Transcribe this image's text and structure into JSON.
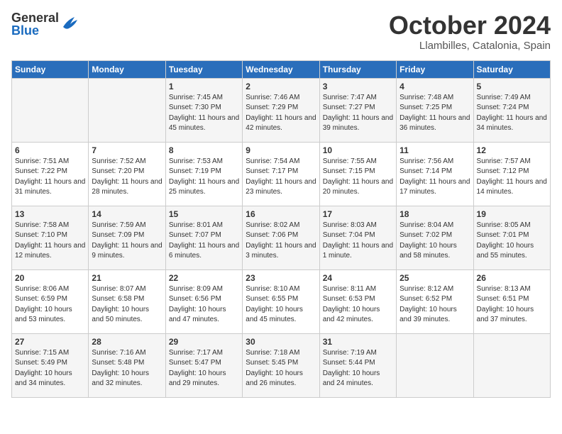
{
  "header": {
    "logo_general": "General",
    "logo_blue": "Blue",
    "month": "October 2024",
    "location": "Llambilles, Catalonia, Spain"
  },
  "days_of_week": [
    "Sunday",
    "Monday",
    "Tuesday",
    "Wednesday",
    "Thursday",
    "Friday",
    "Saturday"
  ],
  "weeks": [
    [
      {
        "day": "",
        "info": ""
      },
      {
        "day": "",
        "info": ""
      },
      {
        "day": "1",
        "info": "Sunrise: 7:45 AM\nSunset: 7:30 PM\nDaylight: 11 hours and 45 minutes."
      },
      {
        "day": "2",
        "info": "Sunrise: 7:46 AM\nSunset: 7:29 PM\nDaylight: 11 hours and 42 minutes."
      },
      {
        "day": "3",
        "info": "Sunrise: 7:47 AM\nSunset: 7:27 PM\nDaylight: 11 hours and 39 minutes."
      },
      {
        "day": "4",
        "info": "Sunrise: 7:48 AM\nSunset: 7:25 PM\nDaylight: 11 hours and 36 minutes."
      },
      {
        "day": "5",
        "info": "Sunrise: 7:49 AM\nSunset: 7:24 PM\nDaylight: 11 hours and 34 minutes."
      }
    ],
    [
      {
        "day": "6",
        "info": "Sunrise: 7:51 AM\nSunset: 7:22 PM\nDaylight: 11 hours and 31 minutes."
      },
      {
        "day": "7",
        "info": "Sunrise: 7:52 AM\nSunset: 7:20 PM\nDaylight: 11 hours and 28 minutes."
      },
      {
        "day": "8",
        "info": "Sunrise: 7:53 AM\nSunset: 7:19 PM\nDaylight: 11 hours and 25 minutes."
      },
      {
        "day": "9",
        "info": "Sunrise: 7:54 AM\nSunset: 7:17 PM\nDaylight: 11 hours and 23 minutes."
      },
      {
        "day": "10",
        "info": "Sunrise: 7:55 AM\nSunset: 7:15 PM\nDaylight: 11 hours and 20 minutes."
      },
      {
        "day": "11",
        "info": "Sunrise: 7:56 AM\nSunset: 7:14 PM\nDaylight: 11 hours and 17 minutes."
      },
      {
        "day": "12",
        "info": "Sunrise: 7:57 AM\nSunset: 7:12 PM\nDaylight: 11 hours and 14 minutes."
      }
    ],
    [
      {
        "day": "13",
        "info": "Sunrise: 7:58 AM\nSunset: 7:10 PM\nDaylight: 11 hours and 12 minutes."
      },
      {
        "day": "14",
        "info": "Sunrise: 7:59 AM\nSunset: 7:09 PM\nDaylight: 11 hours and 9 minutes."
      },
      {
        "day": "15",
        "info": "Sunrise: 8:01 AM\nSunset: 7:07 PM\nDaylight: 11 hours and 6 minutes."
      },
      {
        "day": "16",
        "info": "Sunrise: 8:02 AM\nSunset: 7:06 PM\nDaylight: 11 hours and 3 minutes."
      },
      {
        "day": "17",
        "info": "Sunrise: 8:03 AM\nSunset: 7:04 PM\nDaylight: 11 hours and 1 minute."
      },
      {
        "day": "18",
        "info": "Sunrise: 8:04 AM\nSunset: 7:02 PM\nDaylight: 10 hours and 58 minutes."
      },
      {
        "day": "19",
        "info": "Sunrise: 8:05 AM\nSunset: 7:01 PM\nDaylight: 10 hours and 55 minutes."
      }
    ],
    [
      {
        "day": "20",
        "info": "Sunrise: 8:06 AM\nSunset: 6:59 PM\nDaylight: 10 hours and 53 minutes."
      },
      {
        "day": "21",
        "info": "Sunrise: 8:07 AM\nSunset: 6:58 PM\nDaylight: 10 hours and 50 minutes."
      },
      {
        "day": "22",
        "info": "Sunrise: 8:09 AM\nSunset: 6:56 PM\nDaylight: 10 hours and 47 minutes."
      },
      {
        "day": "23",
        "info": "Sunrise: 8:10 AM\nSunset: 6:55 PM\nDaylight: 10 hours and 45 minutes."
      },
      {
        "day": "24",
        "info": "Sunrise: 8:11 AM\nSunset: 6:53 PM\nDaylight: 10 hours and 42 minutes."
      },
      {
        "day": "25",
        "info": "Sunrise: 8:12 AM\nSunset: 6:52 PM\nDaylight: 10 hours and 39 minutes."
      },
      {
        "day": "26",
        "info": "Sunrise: 8:13 AM\nSunset: 6:51 PM\nDaylight: 10 hours and 37 minutes."
      }
    ],
    [
      {
        "day": "27",
        "info": "Sunrise: 7:15 AM\nSunset: 5:49 PM\nDaylight: 10 hours and 34 minutes."
      },
      {
        "day": "28",
        "info": "Sunrise: 7:16 AM\nSunset: 5:48 PM\nDaylight: 10 hours and 32 minutes."
      },
      {
        "day": "29",
        "info": "Sunrise: 7:17 AM\nSunset: 5:47 PM\nDaylight: 10 hours and 29 minutes."
      },
      {
        "day": "30",
        "info": "Sunrise: 7:18 AM\nSunset: 5:45 PM\nDaylight: 10 hours and 26 minutes."
      },
      {
        "day": "31",
        "info": "Sunrise: 7:19 AM\nSunset: 5:44 PM\nDaylight: 10 hours and 24 minutes."
      },
      {
        "day": "",
        "info": ""
      },
      {
        "day": "",
        "info": ""
      }
    ]
  ]
}
